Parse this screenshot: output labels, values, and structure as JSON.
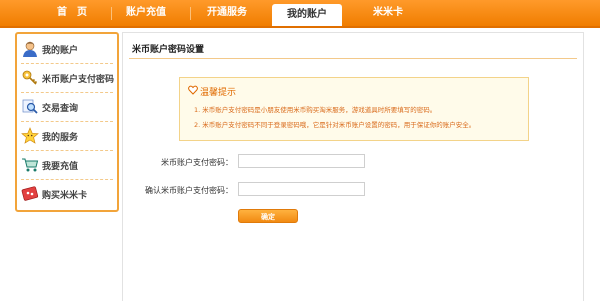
{
  "nav": {
    "items": [
      {
        "label": "首　页"
      },
      {
        "label": "账户充值"
      },
      {
        "label": "开通服务"
      },
      {
        "label": "我的账户",
        "active": true
      },
      {
        "label": "米米卡"
      }
    ]
  },
  "sidebar": {
    "items": [
      {
        "label": "我的账户",
        "icon": "user-avatar-icon"
      },
      {
        "label": "米币账户支付密码",
        "icon": "key-icon"
      },
      {
        "label": "交易查询",
        "icon": "magnifier-icon"
      },
      {
        "label": "我的服务",
        "icon": "star-icon"
      },
      {
        "label": "我要充值",
        "icon": "cart-icon"
      },
      {
        "label": "购买米米卡",
        "icon": "gift-card-icon"
      }
    ]
  },
  "main": {
    "title": "米币账户密码设置",
    "tips": {
      "title": "温馨提示",
      "lines": [
        "1. 米币账户支付密码是小朋友使用米币购买淘米服务，游戏道具时所要填写的密码。",
        "2. 米币账户支付密码不同于登录密码哦，它是针对米币账户设置的密码，用于保证你的账户安全。"
      ]
    },
    "form": {
      "password_label": "米币账户支付密码：",
      "password_value": "",
      "confirm_label": "确认米币账户支付密码：",
      "confirm_value": "",
      "submit_label": "确定"
    }
  },
  "colors": {
    "nav_orange": "#f38a14",
    "border_orange": "#f2a43a",
    "tip_text": "#d96a1a",
    "tip_bg": "#fffbea"
  }
}
